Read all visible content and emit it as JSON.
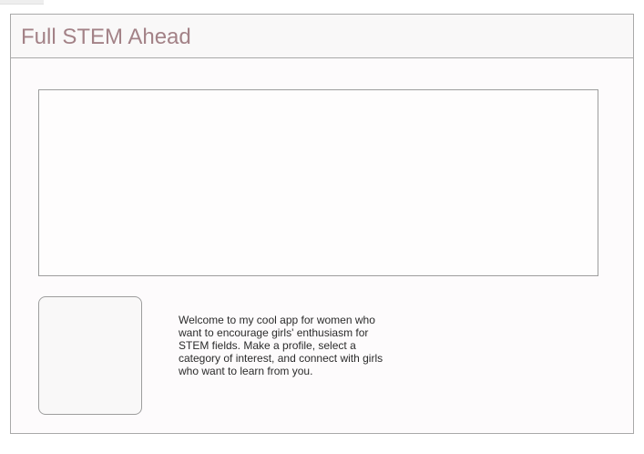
{
  "header": {
    "title": "Full STEM Ahead"
  },
  "main": {
    "welcome_text": "Welcome to my cool app for women who want to encourage girls' enthusiasm for STEM fields. Make a profile, select a category of interest, and connect with girls who want to learn from you."
  },
  "colors": {
    "title": "#a38287",
    "border": "#a9a9a9",
    "background": "#fdfbfc"
  }
}
